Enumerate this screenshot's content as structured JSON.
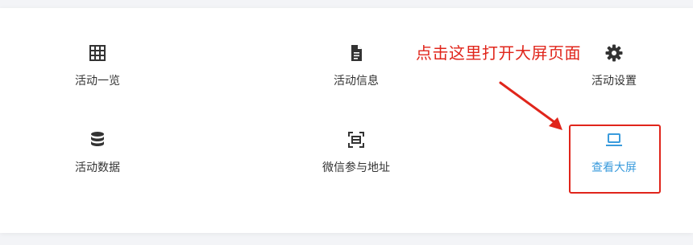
{
  "tiles": [
    {
      "label": "活动一览",
      "icon": "grid-icon"
    },
    {
      "label": "活动信息",
      "icon": "document-icon"
    },
    {
      "label": "活动设置",
      "icon": "gear-icon"
    },
    {
      "label": "活动数据",
      "icon": "database-icon"
    },
    {
      "label": "微信参与地址",
      "icon": "scan-frame-icon"
    },
    {
      "label": "查看大屏",
      "icon": "laptop-icon"
    }
  ],
  "annotation": {
    "text": "点击这里打开大屏页面",
    "color": "#e0251b"
  },
  "colors": {
    "icon_default": "#333333",
    "icon_highlight": "#3a9bdc",
    "label_highlight": "#3a9bdc"
  }
}
